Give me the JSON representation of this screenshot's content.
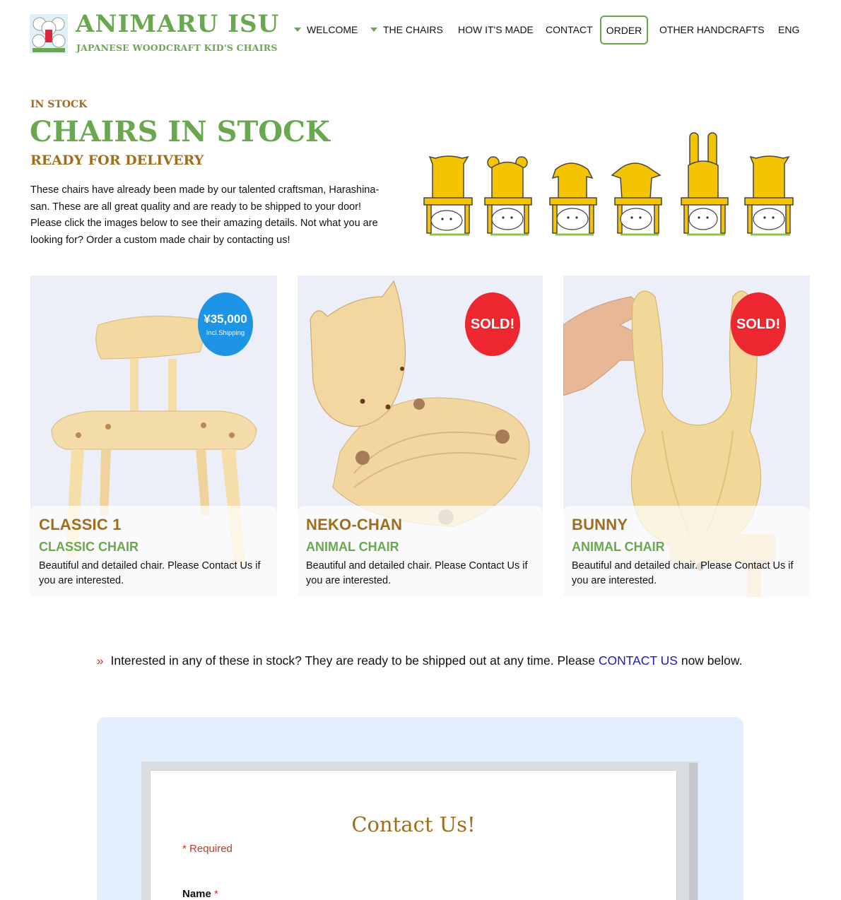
{
  "brand": {
    "title": "ANIMARU ISU",
    "subtitle": "JAPANESE WOODCRAFT KID'S CHAIRS",
    "color": "#6aa84f"
  },
  "nav": {
    "items": [
      {
        "label": "WELCOME",
        "dropdown": true
      },
      {
        "label": "THE CHAIRS",
        "dropdown": true
      },
      {
        "label": "HOW IT'S MADE",
        "dropdown": false
      },
      {
        "label": "CONTACT",
        "dropdown": false
      },
      {
        "label": "ORDER",
        "dropdown": false,
        "highlighted": true
      },
      {
        "label": "OTHER HANDCRAFTS",
        "dropdown": false
      },
      {
        "label": "ENG",
        "dropdown": false
      }
    ]
  },
  "intro": {
    "kicker": "IN STOCK",
    "title": "CHAIRS IN STOCK",
    "subtitle": "READY FOR DELIVERY",
    "text": "These chairs have already been made by our talented craftsman, Harashina-san. These are all great quality and are ready to be shipped to your door! Please click the images below to see their amazing details. Not what you are looking for? Order a custom made chair by contacting us!"
  },
  "cards": [
    {
      "name": "CLASSIC 1",
      "type": "CLASSIC CHAIR",
      "description": "Beautiful and detailed chair. Please Contact Us if you are interested.",
      "badge": {
        "kind": "price",
        "text": "¥35,000",
        "note": "Incl.Shipping",
        "color": "#1e94e6"
      }
    },
    {
      "name": "NEKO-CHAN",
      "type": "ANIMAL CHAIR",
      "description": "Beautiful and detailed chair. Please Contact Us if you are interested.",
      "badge": {
        "kind": "sold",
        "text": "SOLD!",
        "color": "#ec2730"
      }
    },
    {
      "name": "BUNNY",
      "type": "ANIMAL CHAIR",
      "description": "Beautiful and detailed chair. Please Contact Us if you are interested.",
      "badge": {
        "kind": "sold",
        "text": "SOLD!",
        "color": "#ec2730"
      }
    }
  ],
  "interest": {
    "before": "Interested in any of these in stock? They are ready to be shipped out at any time. Please ",
    "link": "CONTACT US",
    "after": " now below."
  },
  "contact_form": {
    "title": "Contact Us!",
    "required_note": "* Required",
    "name_label": "Name",
    "name_required_mark": "*"
  },
  "colors": {
    "accent_green": "#6aa84f",
    "accent_brown": "#a06d1c",
    "link_blue": "#1a1ab8",
    "form_background": "#e3effc"
  }
}
